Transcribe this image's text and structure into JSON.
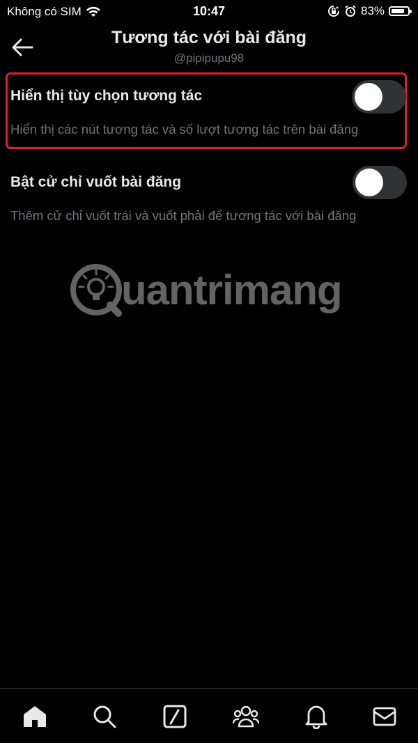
{
  "status_bar": {
    "carrier": "Không có SIM",
    "time": "10:47",
    "battery_percent": "83%",
    "battery_level": 0.83,
    "icons": [
      "wifi-icon",
      "orientation-lock-icon",
      "alarm-icon",
      "battery-icon"
    ]
  },
  "header": {
    "title": "Tương tác với bài đăng",
    "username": "@pipipupu98",
    "back_icon": "back-arrow-icon"
  },
  "settings": [
    {
      "title": "Hiển thị tùy chọn tương tác",
      "description": "Hiển thị các nút tương tác và số lượt tương tác trên bài đăng",
      "enabled": false,
      "highlighted": true
    },
    {
      "title": "Bật cử chỉ vuốt bài đăng",
      "description": "Thêm cử chỉ vuốt trái và vuốt phải để tương tác với bài đăng",
      "enabled": false,
      "highlighted": false
    }
  ],
  "watermark": {
    "text": "uantrimang"
  },
  "bottom_nav": {
    "items": [
      "home-icon",
      "search-icon",
      "grok-icon",
      "communities-icon",
      "notifications-icon",
      "messages-icon"
    ],
    "active": "home-icon"
  },
  "colors": {
    "background": "#000000",
    "primary_text": "#e7e9ea",
    "secondary_text": "#71767b",
    "toggle_off": "#2f3336",
    "highlight": "#e0202a"
  }
}
